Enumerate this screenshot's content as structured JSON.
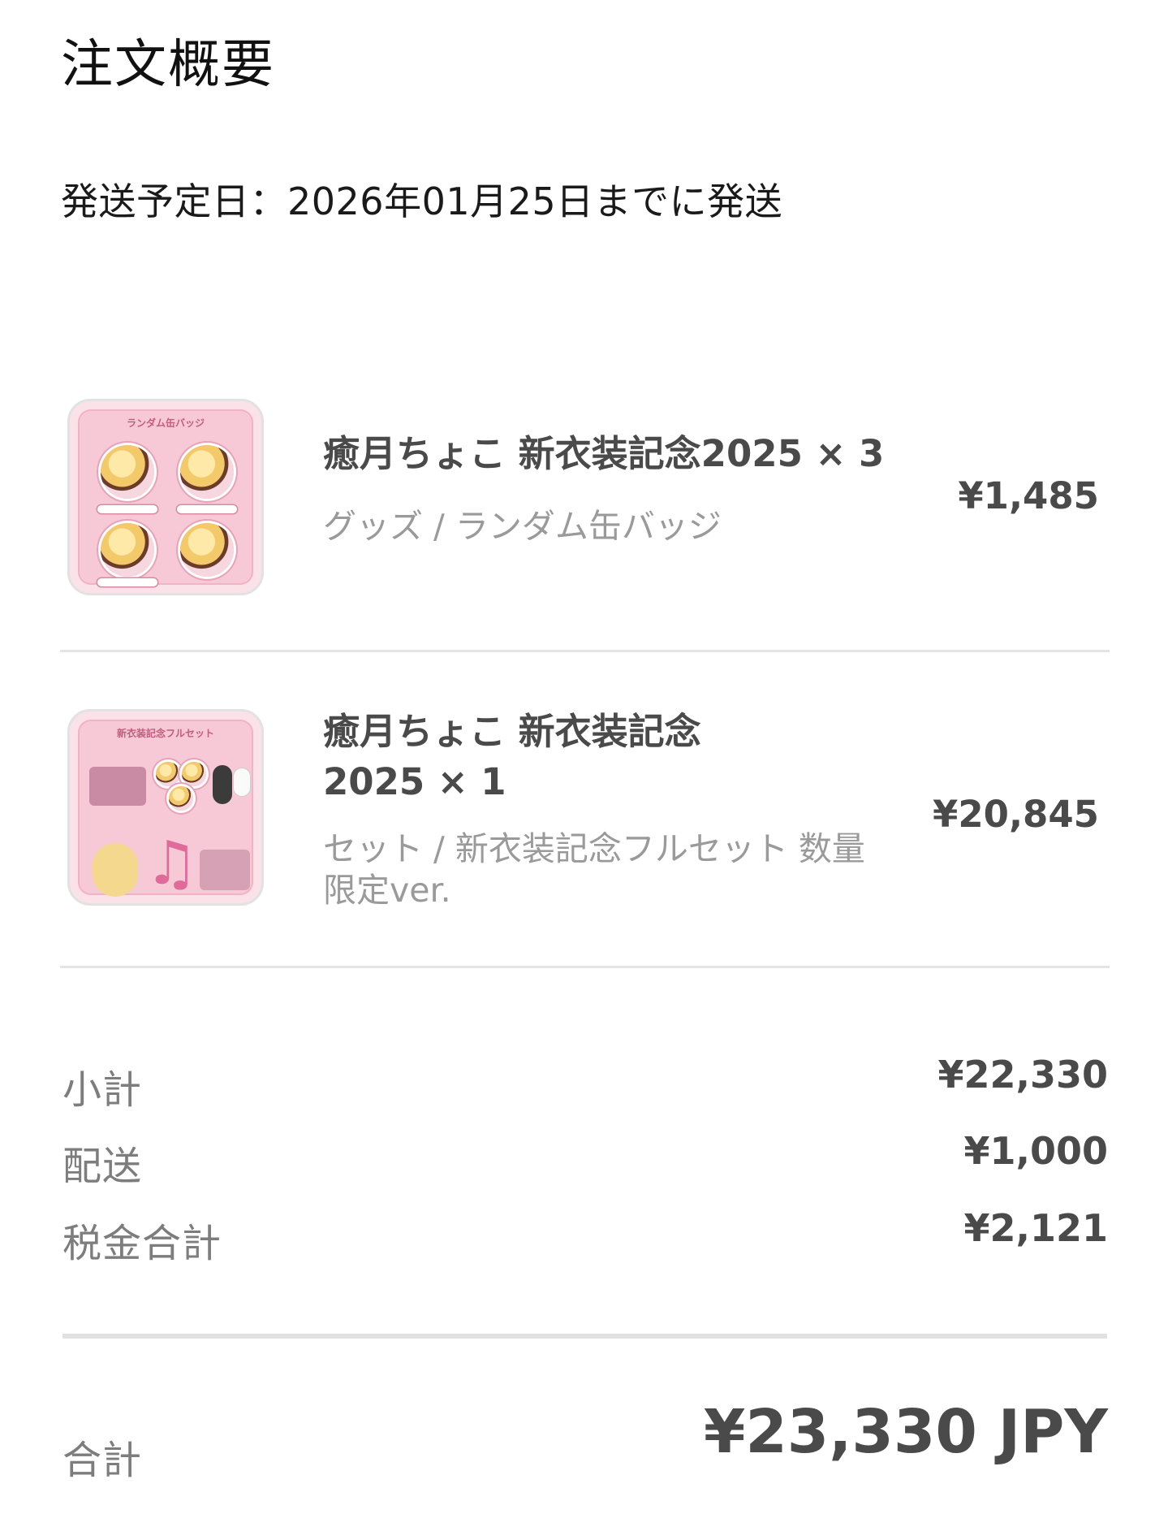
{
  "header": {
    "title": "注文概要",
    "ship_date": "発送予定日：2026年01月25日までに発送"
  },
  "items": [
    {
      "name": "癒月ちょこ 新衣装記念2025 × 3",
      "variant": "グッズ / ランダム缶バッジ",
      "price": "¥1,485",
      "thumbnail_icon": "product-image-random-can-badge",
      "thumbnail_caption": "ランダム缶バッジ"
    },
    {
      "name": "癒月ちょこ 新衣装記念2025 × 1",
      "variant": "セット / 新衣装記念フルセット 数量限定ver.",
      "price": "¥20,845",
      "thumbnail_icon": "product-image-full-set",
      "thumbnail_caption": "新衣装記念フルセット"
    }
  ],
  "summary": {
    "subtotal_label": "小計",
    "subtotal_value": "¥22,330",
    "shipping_label": "配送",
    "shipping_value": "¥1,000",
    "tax_label": "税金合計",
    "tax_value": "¥2,121",
    "total_label": "合計",
    "total_value": "¥23,330 JPY"
  },
  "colors": {
    "text_primary": "#1a1a1a",
    "text_bold": "#4a4a4a",
    "text_muted": "#9a9a9a",
    "label_muted": "#7d7d7d",
    "divider": "#e4e4e4",
    "thumb_pink": "#f7c9d6"
  }
}
